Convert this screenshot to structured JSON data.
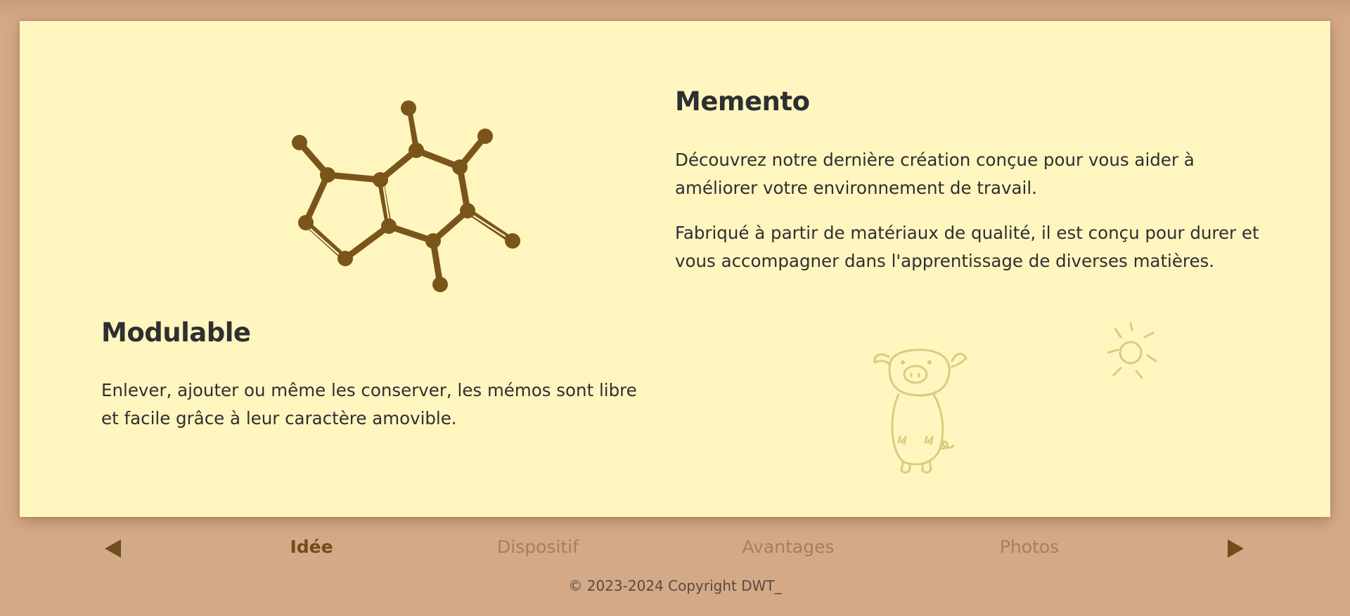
{
  "colors": {
    "page_background": "#d4a987",
    "card_background": "#fff5bf",
    "text": "#2e2f31",
    "molecule": "#7a551a",
    "doodle": "#d9cc7e",
    "nav_active": "#6d4e1c",
    "nav_inactive": "#a27f66"
  },
  "memento": {
    "title": "Memento",
    "paragraph_1": "Découvrez notre dernière création conçue pour vous aider à améliorer votre environnement de travail.",
    "paragraph_2": "Fabriqué à partir de matériaux de qualité, il est conçu pour durer et vous accompagner dans l'apprentissage de diverses matières."
  },
  "modulable": {
    "title": "Modulable",
    "paragraph": "Enlever, ajouter ou même les conserver, les mémos sont libre et facile grâce à leur caractère amovible."
  },
  "icons": {
    "molecule": "caffeine-molecule-icon",
    "pig": "pig-doodle-icon",
    "sun": "sun-doodle-icon",
    "previous": "triangle-left-icon",
    "next": "triangle-right-icon"
  },
  "nav": {
    "tabs": [
      {
        "label": "Idée",
        "active": true
      },
      {
        "label": "Dispositif",
        "active": false
      },
      {
        "label": "Avantages",
        "active": false
      },
      {
        "label": "Photos",
        "active": false
      }
    ]
  },
  "footer": {
    "copyright": "© 2023-2024 Copyright DWT_"
  }
}
